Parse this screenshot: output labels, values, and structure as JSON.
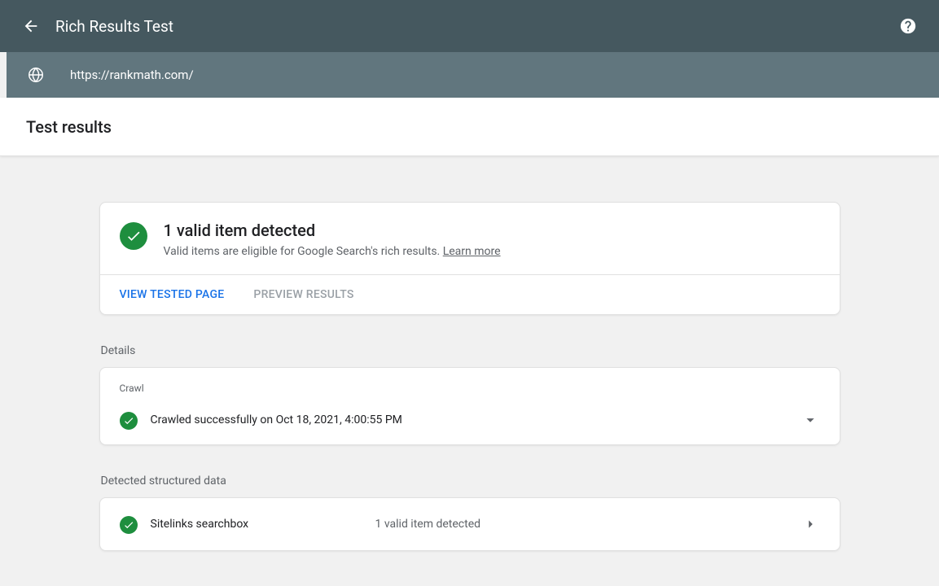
{
  "header": {
    "title": "Rich Results Test"
  },
  "url": "https://rankmath.com/",
  "tabs": {
    "results": "Test results"
  },
  "summary": {
    "title": "1 valid item detected",
    "subtitle_prefix": "Valid items are eligible for Google Search's rich results. ",
    "learn_more": "Learn more",
    "actions": {
      "view": "VIEW TESTED PAGE",
      "preview": "PREVIEW RESULTS"
    }
  },
  "sections": {
    "details": "Details",
    "detected": "Detected structured data"
  },
  "crawl": {
    "label": "Crawl",
    "status": "Crawled successfully on Oct 18, 2021, 4:00:55 PM"
  },
  "detected": {
    "name": "Sitelinks searchbox",
    "status": "1 valid item detected"
  }
}
